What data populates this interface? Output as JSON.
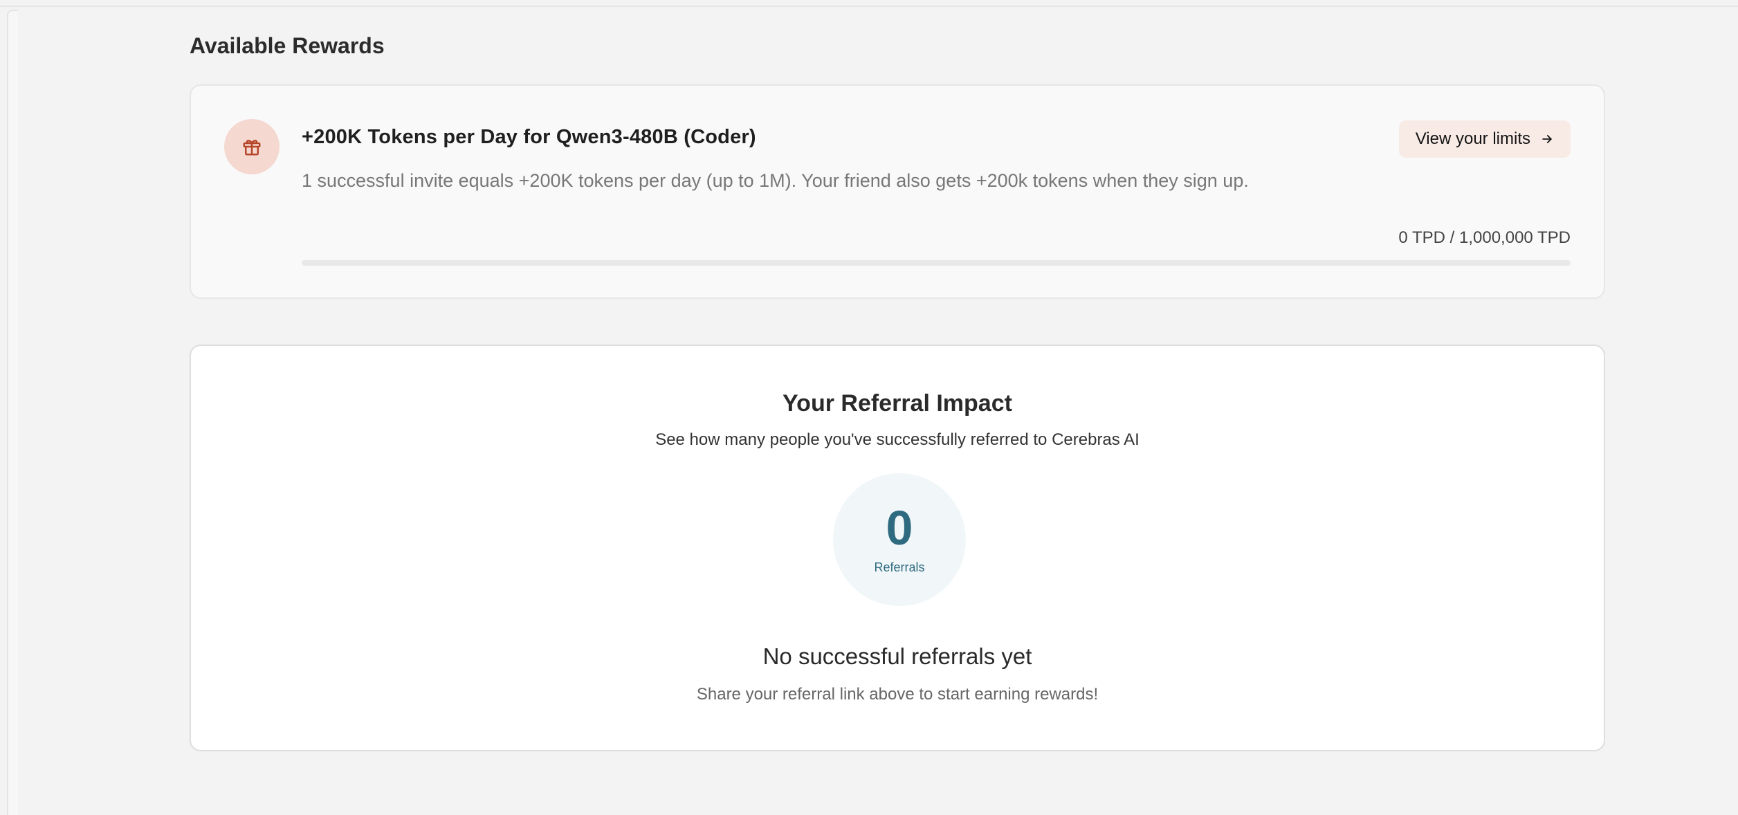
{
  "rewards": {
    "section_title": "Available Rewards",
    "card": {
      "icon": "gift-icon",
      "title": "+200K Tokens per Day for Qwen3-480B (Coder)",
      "description": "1 successful invite equals +200K tokens per day (up to 1M). Your friend also gets +200k tokens when they sign up.",
      "limits_button_label": "View your limits",
      "limits_button_icon": "arrow-right-icon",
      "progress_label": "0 TPD / 1,000,000 TPD",
      "progress_value": 0,
      "progress_max": 1000000
    }
  },
  "impact": {
    "title": "Your Referral Impact",
    "subtitle": "See how many people you've successfully referred to Cerebras AI",
    "count": "0",
    "count_label": "Referrals",
    "empty_title": "No successful referrals yet",
    "empty_subtitle": "Share your referral link above to start earning rewards!"
  },
  "colors": {
    "page_background": "#f3f3f3",
    "gift_badge_bg": "#f5d8d0",
    "gift_icon": "#b5462a",
    "limits_button_bg": "#f8ebe6",
    "count_circle_bg": "#f1f7f9",
    "count_text": "#2e6a80"
  }
}
